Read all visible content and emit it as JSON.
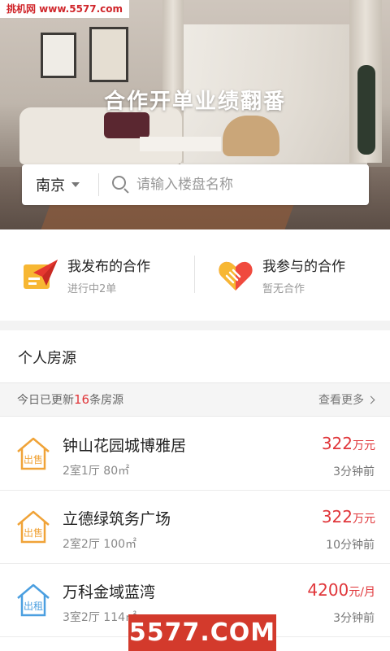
{
  "watermark_top": "挑机网 www.5577.com",
  "hero": {
    "title": "合作开单业绩翻番"
  },
  "search": {
    "city": "南京",
    "placeholder": "请输入楼盘名称"
  },
  "cooperation": [
    {
      "title": "我发布的合作",
      "subtitle": "进行中2单",
      "icon": "paper-plane-icon"
    },
    {
      "title": "我参与的合作",
      "subtitle": "暂无合作",
      "icon": "heart-handshake-icon"
    }
  ],
  "section": {
    "title": "个人房源",
    "update_prefix": "今日已更新",
    "update_count": "16",
    "update_suffix": "条房源",
    "more": "查看更多"
  },
  "listings": [
    {
      "tag": "出售",
      "name": "钟山花园城博雅居",
      "layout": "2室1厅",
      "area": "80㎡",
      "price": "322",
      "unit": "万元",
      "time": "3分钟前"
    },
    {
      "tag": "出售",
      "name": "立德绿筑务广场",
      "layout": "2室2厅",
      "area": "100㎡",
      "price": "322",
      "unit": "万元",
      "time": "10分钟前"
    },
    {
      "tag": "出租",
      "name": "万科金域蓝湾",
      "layout": "3室2厅",
      "area": "114㎡",
      "price": "4200",
      "unit": "元/月",
      "time": "3分钟前"
    }
  ],
  "watermark_bottom": "5577.COM",
  "colors": {
    "accent_red": "#e0363a",
    "sale_tag": "#f0a338",
    "rent_tag": "#4b9fe0"
  }
}
